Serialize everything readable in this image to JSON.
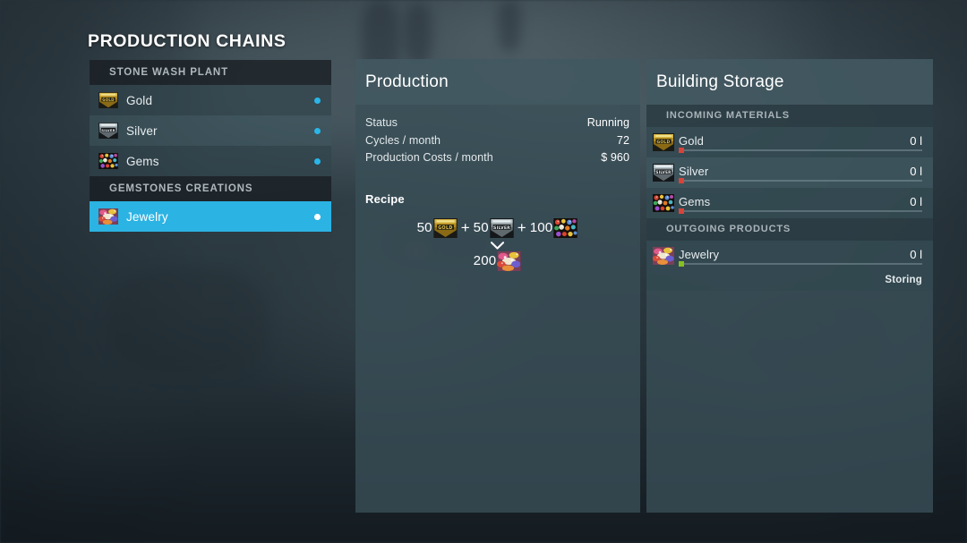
{
  "page": {
    "title": "PRODUCTION CHAINS"
  },
  "colors": {
    "accent": "#2bb3e3",
    "dot": "#2ab6e8",
    "panel_bg": "#3a4f57",
    "bar_low": "#d8443a",
    "bar_ok": "#88c020",
    "text": "#e8edef"
  },
  "chain_list": {
    "groups": [
      {
        "label": "STONE WASH PLANT",
        "items": [
          {
            "label": "Gold",
            "icon": "gold-bar-icon",
            "selected": false,
            "status_dot": "cyan"
          },
          {
            "label": "Silver",
            "icon": "silver-bar-icon",
            "selected": false,
            "status_dot": "cyan"
          },
          {
            "label": "Gems",
            "icon": "gems-icon",
            "selected": false,
            "status_dot": "cyan"
          }
        ]
      },
      {
        "label": "GEMSTONES CREATIONS",
        "items": [
          {
            "label": "Jewelry",
            "icon": "jewelry-icon",
            "selected": true,
            "status_dot": "white"
          }
        ]
      }
    ]
  },
  "production": {
    "title": "Production",
    "stats": [
      {
        "label": "Status",
        "value": "Running"
      },
      {
        "label": "Cycles / month",
        "value": "72"
      },
      {
        "label": "Production Costs / month",
        "value": "$ 960"
      }
    ],
    "recipe": {
      "title": "Recipe",
      "inputs": [
        {
          "amount": "50",
          "icon": "gold-bar-icon"
        },
        {
          "amount": "50",
          "icon": "silver-bar-icon"
        },
        {
          "amount": "100",
          "icon": "gems-icon"
        }
      ],
      "separator": "+",
      "arrow": "chevron-down-icon",
      "outputs": [
        {
          "amount": "200",
          "icon": "jewelry-icon"
        }
      ]
    }
  },
  "storage": {
    "title": "Building Storage",
    "sections": [
      {
        "label": "INCOMING MATERIALS",
        "rows": [
          {
            "label": "Gold",
            "amount": "0 l",
            "icon": "gold-bar-icon",
            "fill_state": "empty",
            "note": ""
          },
          {
            "label": "Silver",
            "amount": "0 l",
            "icon": "silver-bar-icon",
            "fill_state": "empty",
            "note": ""
          },
          {
            "label": "Gems",
            "amount": "0 l",
            "icon": "gems-icon",
            "fill_state": "empty",
            "note": ""
          }
        ]
      },
      {
        "label": "OUTGOING PRODUCTS",
        "rows": [
          {
            "label": "Jewelry",
            "amount": "0 l",
            "icon": "jewelry-icon",
            "fill_state": "ok",
            "note": "Storing"
          }
        ]
      }
    ]
  }
}
